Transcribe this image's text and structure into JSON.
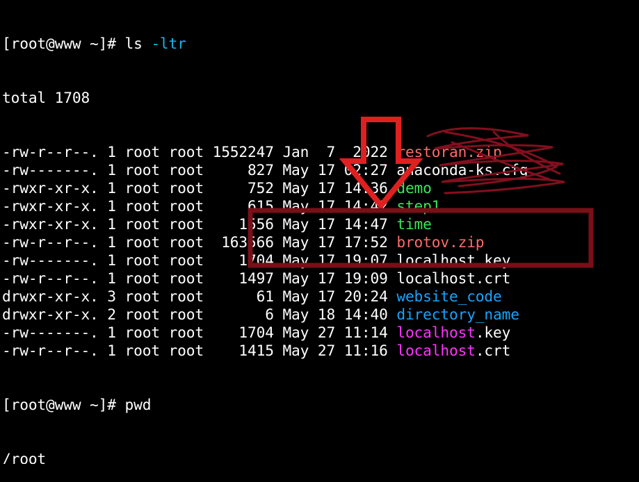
{
  "colors": {
    "background": "#000000",
    "text": "#ffffff",
    "command_option": "#19b5e8",
    "archive": "#ff6b6b",
    "executable": "#39e65a",
    "directory": "#1aa3ff",
    "highlight_file": "#ff33ff",
    "annotation_red": "#e02020",
    "annotation_box": "#7a0f18",
    "scribble": "#8a1020"
  },
  "terminal": {
    "prompt1": "[root@www ~]# ",
    "cmd1": "ls ",
    "cmd1_opt": "-ltr",
    "total": "total 1708",
    "files": [
      {
        "perm": "-rw-r--r--.",
        "links": "1",
        "owner": "root",
        "group": "root",
        "size": "1552247",
        "date": "Jan  7  2022",
        "name": "restoran.zip",
        "type": "archive"
      },
      {
        "perm": "-rw-------.",
        "links": "1",
        "owner": "root",
        "group": "root",
        "size": "827",
        "date": "May 17 02:27",
        "name": "anaconda-ks.cfg",
        "type": "plain"
      },
      {
        "perm": "-rwxr-xr-x.",
        "links": "1",
        "owner": "root",
        "group": "root",
        "size": "752",
        "date": "May 17 14:36",
        "name": "demo",
        "type": "executable"
      },
      {
        "perm": "-rwxr-xr-x.",
        "links": "1",
        "owner": "root",
        "group": "root",
        "size": "615",
        "date": "May 17 14:42",
        "name": "step1",
        "type": "executable"
      },
      {
        "perm": "-rwxr-xr-x.",
        "links": "1",
        "owner": "root",
        "group": "root",
        "size": "1556",
        "date": "May 17 14:47",
        "name": "time",
        "type": "executable"
      },
      {
        "perm": "-rw-r--r--.",
        "links": "1",
        "owner": "root",
        "group": "root",
        "size": "163566",
        "date": "May 17 17:52",
        "name": "brotov.zip",
        "type": "archive"
      },
      {
        "perm": "-rw-------.",
        "links": "1",
        "owner": "root",
        "group": "root",
        "size": "1704",
        "date": "May 17 19:07",
        "name": "localhost.key",
        "type": "plain"
      },
      {
        "perm": "-rw-r--r--.",
        "links": "1",
        "owner": "root",
        "group": "root",
        "size": "1497",
        "date": "May 17 19:09",
        "name": "localhost.crt",
        "type": "plain"
      },
      {
        "perm": "drwxr-xr-x.",
        "links": "3",
        "owner": "root",
        "group": "root",
        "size": "61",
        "date": "May 17 20:24",
        "name": "website_code",
        "type": "directory"
      },
      {
        "perm": "drwxr-xr-x.",
        "links": "2",
        "owner": "root",
        "group": "root",
        "size": "6",
        "date": "May 18 14:40",
        "name": "directory_name",
        "type": "directory"
      },
      {
        "perm": "-rw-------.",
        "links": "1",
        "owner": "root",
        "group": "root",
        "size": "1704",
        "date": "May 27 11:14",
        "name_main": "localhost",
        "name_ext": ".key",
        "type": "highlight"
      },
      {
        "perm": "-rw-r--r--.",
        "links": "1",
        "owner": "root",
        "group": "root",
        "size": "1415",
        "date": "May 27 11:16",
        "name_main": "localhost",
        "name_ext": ".crt",
        "type": "highlight"
      }
    ],
    "prompt2": "[root@www ~]# ",
    "cmd2": "pwd",
    "output2": "/root"
  }
}
